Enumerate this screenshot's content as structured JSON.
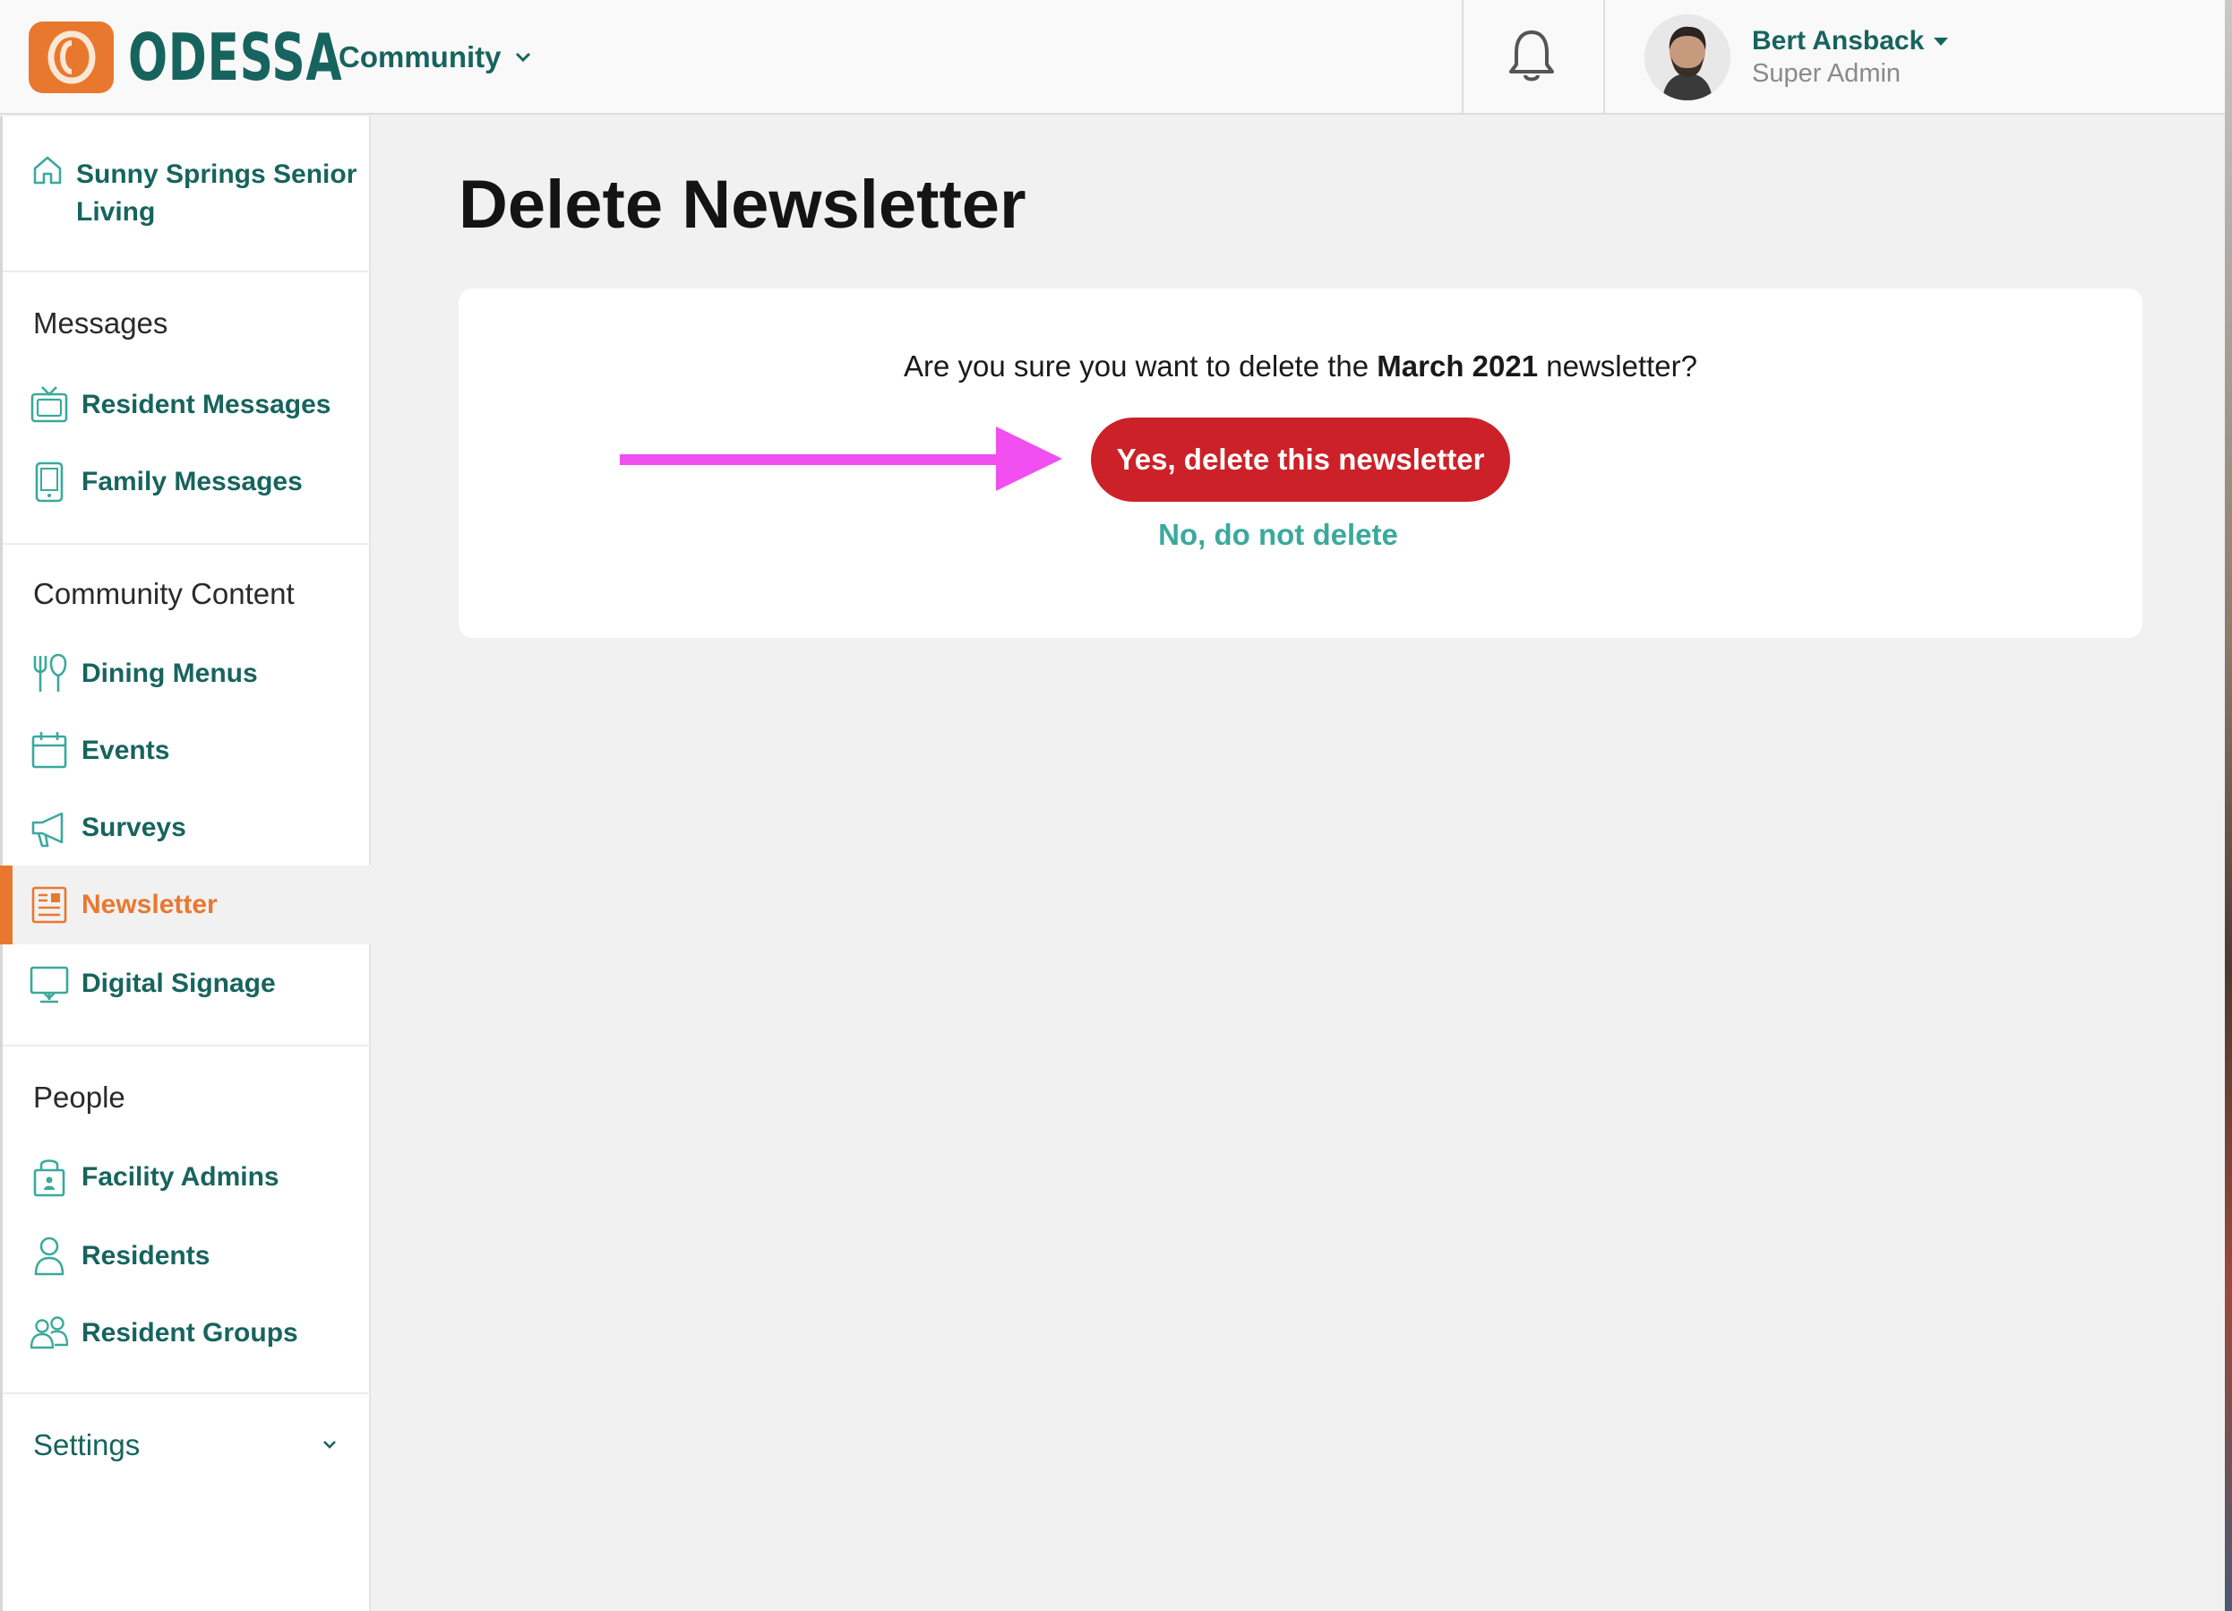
{
  "header": {
    "brand": "ODESSA",
    "community_selector": "Community",
    "user": {
      "name": "Bert Ansback",
      "role": "Super Admin"
    }
  },
  "sidebar": {
    "facility": "Sunny Springs Senior Living",
    "sections": [
      {
        "title": "Messages",
        "items": [
          {
            "label": "Resident Messages",
            "icon": "tv-icon"
          },
          {
            "label": "Family Messages",
            "icon": "phone-icon"
          }
        ]
      },
      {
        "title": "Community Content",
        "items": [
          {
            "label": "Dining Menus",
            "icon": "utensils-icon"
          },
          {
            "label": "Events",
            "icon": "calendar-icon"
          },
          {
            "label": "Surveys",
            "icon": "megaphone-icon"
          },
          {
            "label": "Newsletter",
            "icon": "newspaper-icon",
            "active": true
          },
          {
            "label": "Digital Signage",
            "icon": "monitor-icon"
          }
        ]
      },
      {
        "title": "People",
        "items": [
          {
            "label": "Facility Admins",
            "icon": "lock-badge-icon"
          },
          {
            "label": "Residents",
            "icon": "person-icon"
          },
          {
            "label": "Resident Groups",
            "icon": "group-icon"
          }
        ]
      }
    ],
    "settings_label": "Settings"
  },
  "main": {
    "title": "Delete Newsletter",
    "question_prefix": "Are you sure you want to delete the ",
    "question_bold": "March 2021",
    "question_suffix": " newsletter?",
    "confirm_label": "Yes, delete this newsletter",
    "cancel_label": "No, do not delete"
  },
  "colors": {
    "brand_teal": "#17645e",
    "accent_orange": "#e9782f",
    "danger_red": "#cc2128",
    "link_teal": "#3aa99c",
    "annotation_magenta": "#f14ff0"
  }
}
